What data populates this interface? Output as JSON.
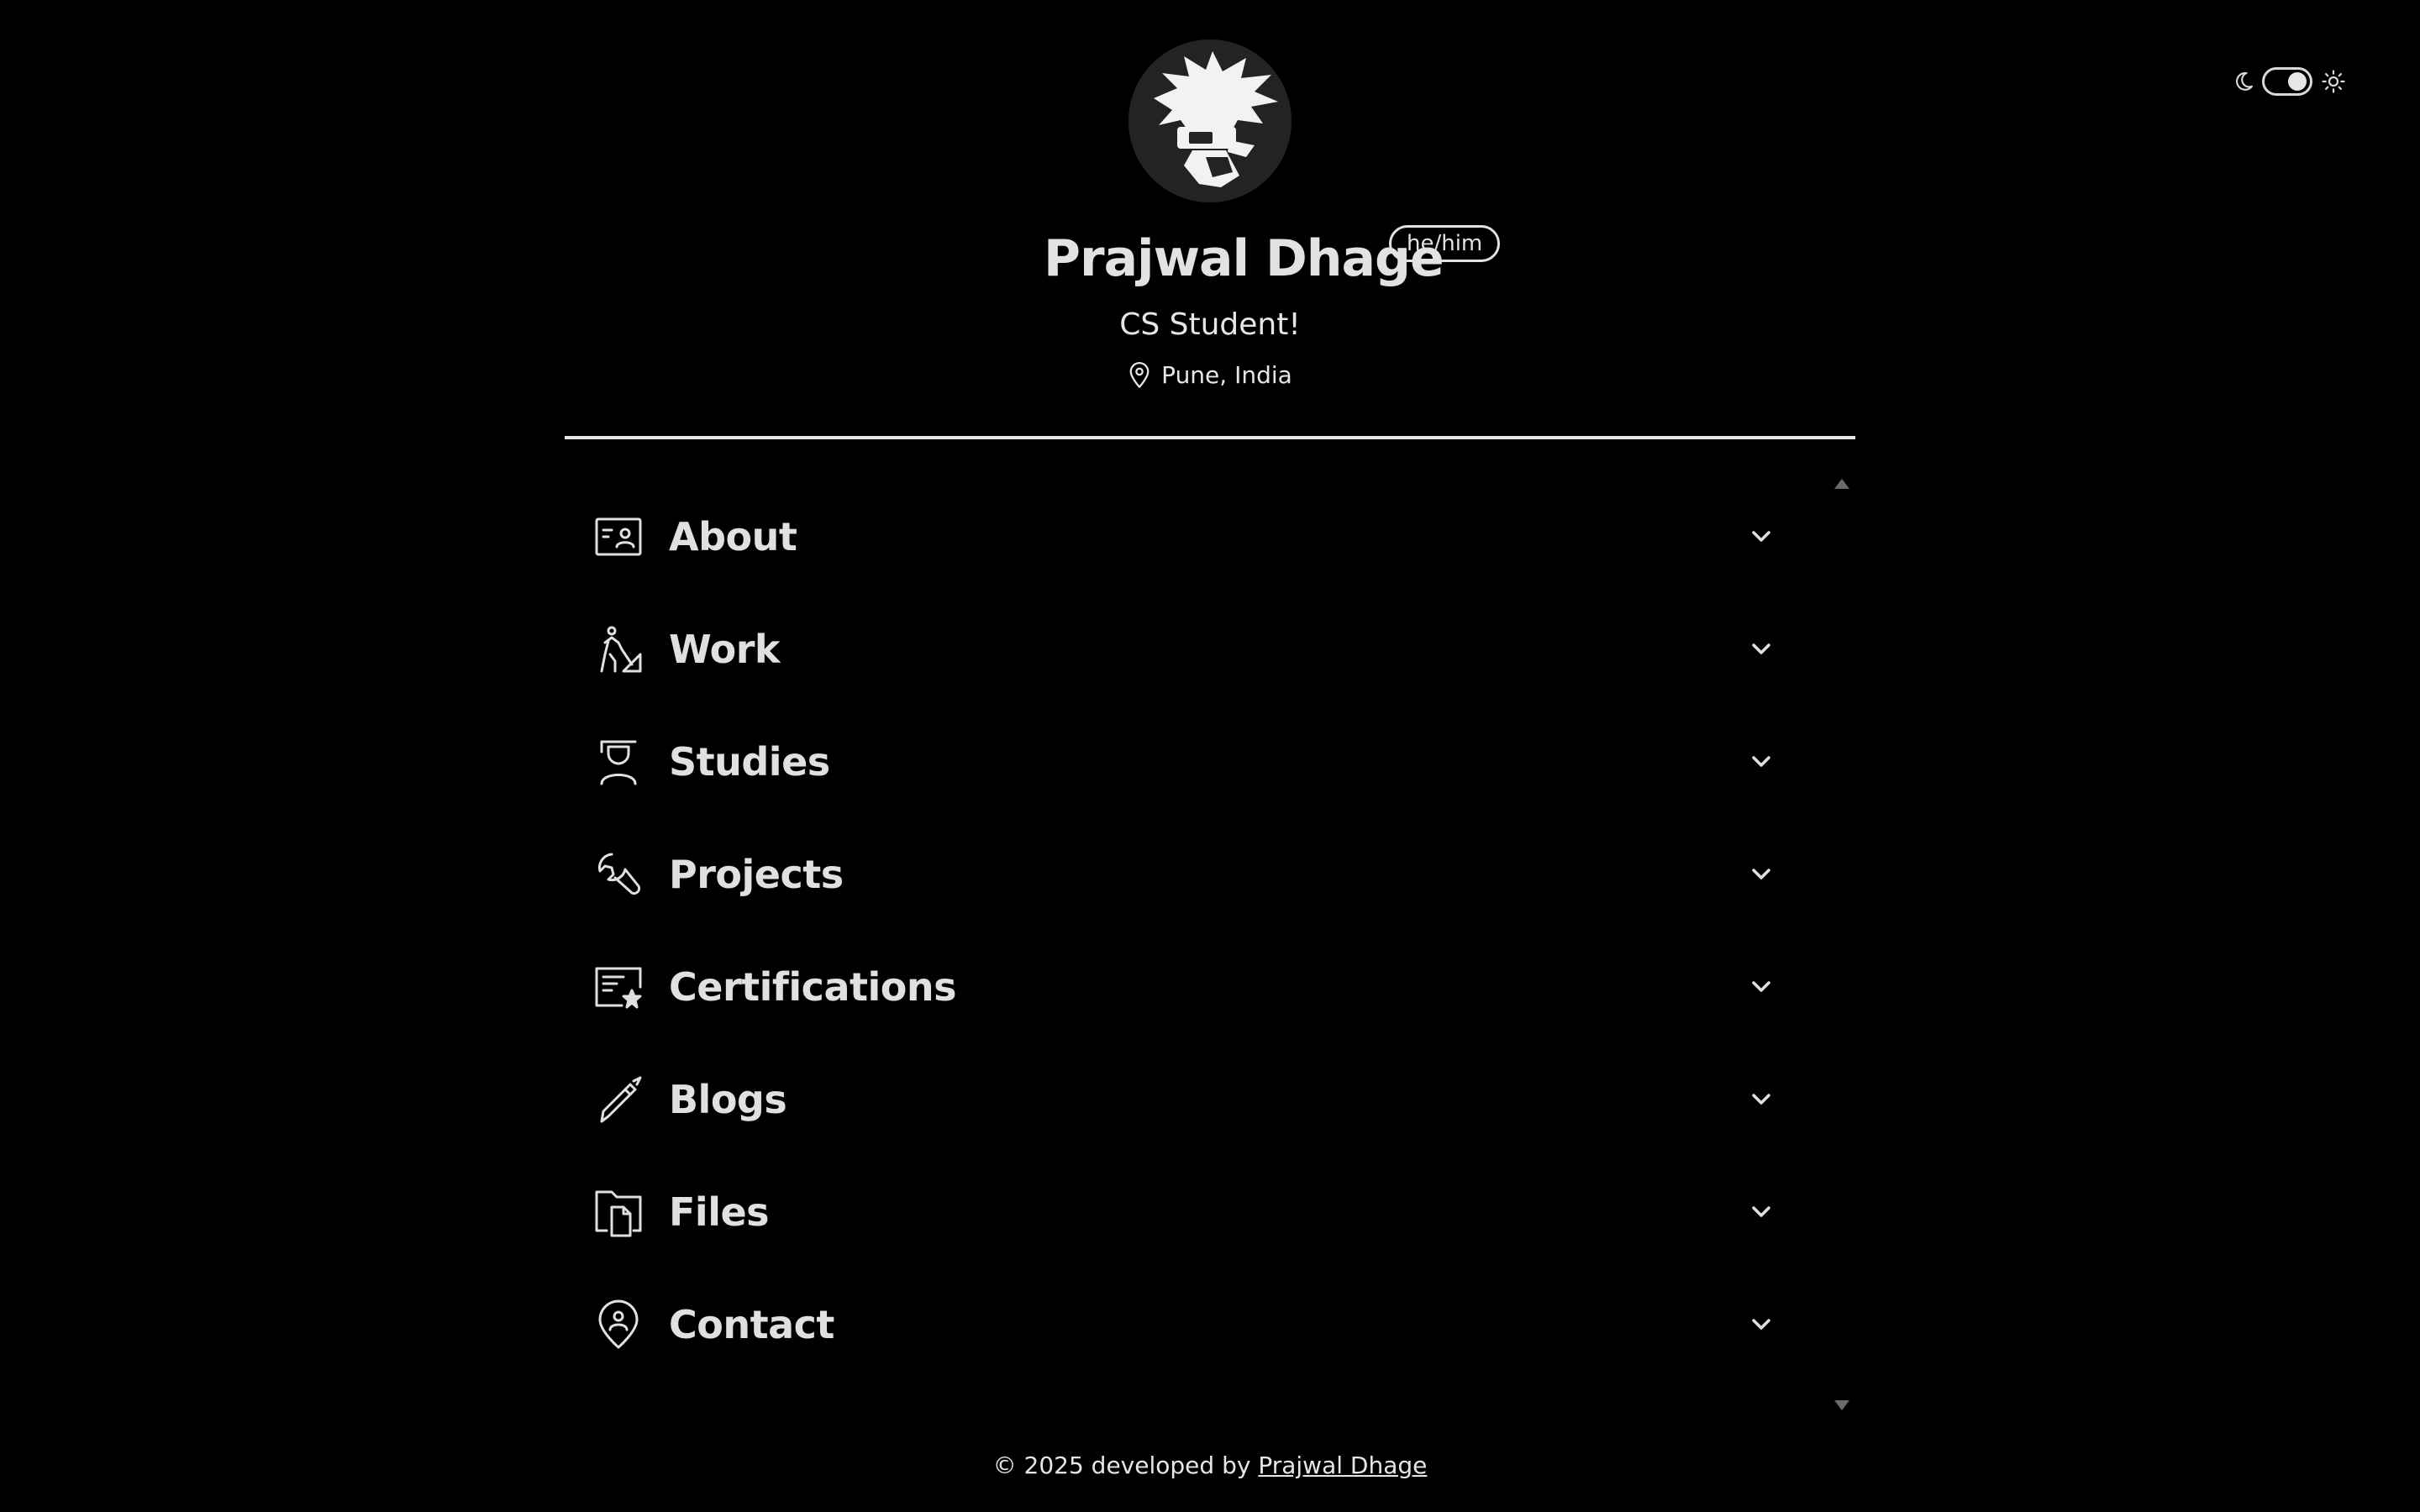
{
  "theme_toggle": {
    "moon_icon": "moon-icon",
    "sun_icon": "sun-icon",
    "state": "dark"
  },
  "profile": {
    "avatar_icon": "avatar-silhouette",
    "name": "Prajwal Dhage",
    "pronouns": "he/him",
    "tagline": "CS Student!",
    "location": "Pune, India",
    "location_icon": "location-pin-icon"
  },
  "sections": [
    {
      "label": "About",
      "icon": "id-card-icon"
    },
    {
      "label": "Work",
      "icon": "worker-icon"
    },
    {
      "label": "Studies",
      "icon": "student-icon"
    },
    {
      "label": "Projects",
      "icon": "wrench-icon"
    },
    {
      "label": "Certifications",
      "icon": "certificate-icon"
    },
    {
      "label": "Blogs",
      "icon": "pencil-icon"
    },
    {
      "label": "Files",
      "icon": "files-icon"
    },
    {
      "label": "Contact",
      "icon": "contact-pin-icon"
    }
  ],
  "footer": {
    "prefix": "© 2025 developed by",
    "link_text": "Prajwal Dhage"
  },
  "colors": {
    "background": "#000000",
    "text": "#e6e6e6",
    "avatar_bg": "#232323",
    "scroll_arrow": "#6b6b6b"
  }
}
